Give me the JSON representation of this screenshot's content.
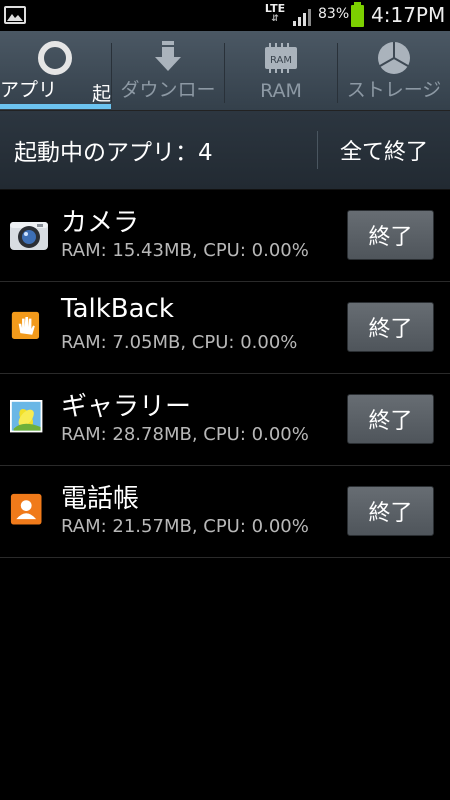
{
  "status_bar": {
    "network": "LTE",
    "network_arrows": "⇵",
    "battery_percent": "83%",
    "time": "4:17PM"
  },
  "tabs": [
    {
      "label": "アプリ",
      "icon": "ring-icon",
      "active": true
    },
    {
      "label": "ダウンロー",
      "icon": "download-icon",
      "active": false
    },
    {
      "label": "RAM",
      "icon": "ram-chip-icon",
      "active": false,
      "icon_text": "RAM"
    },
    {
      "label": "ストレージ",
      "icon": "pie-chart-icon",
      "active": false
    }
  ],
  "tab_peek_label": "起",
  "header": {
    "running_label": "起動中のアプリ：4",
    "end_all_label": "全て終了"
  },
  "apps": [
    {
      "name": "カメラ",
      "stats": "RAM: 15.43MB, CPU: 0.00%",
      "icon": "camera-icon",
      "end_label": "終了"
    },
    {
      "name": "TalkBack",
      "stats": "RAM: 7.05MB, CPU: 0.00%",
      "icon": "hand-icon",
      "end_label": "終了"
    },
    {
      "name": "ギャラリー",
      "stats": "RAM: 28.78MB, CPU: 0.00%",
      "icon": "gallery-icon",
      "end_label": "終了"
    },
    {
      "name": "電話帳",
      "stats": "RAM: 21.57MB, CPU: 0.00%",
      "icon": "contacts-icon",
      "end_label": "終了"
    }
  ],
  "colors": {
    "accent": "#6cc3f0",
    "battery": "#7cd000"
  }
}
